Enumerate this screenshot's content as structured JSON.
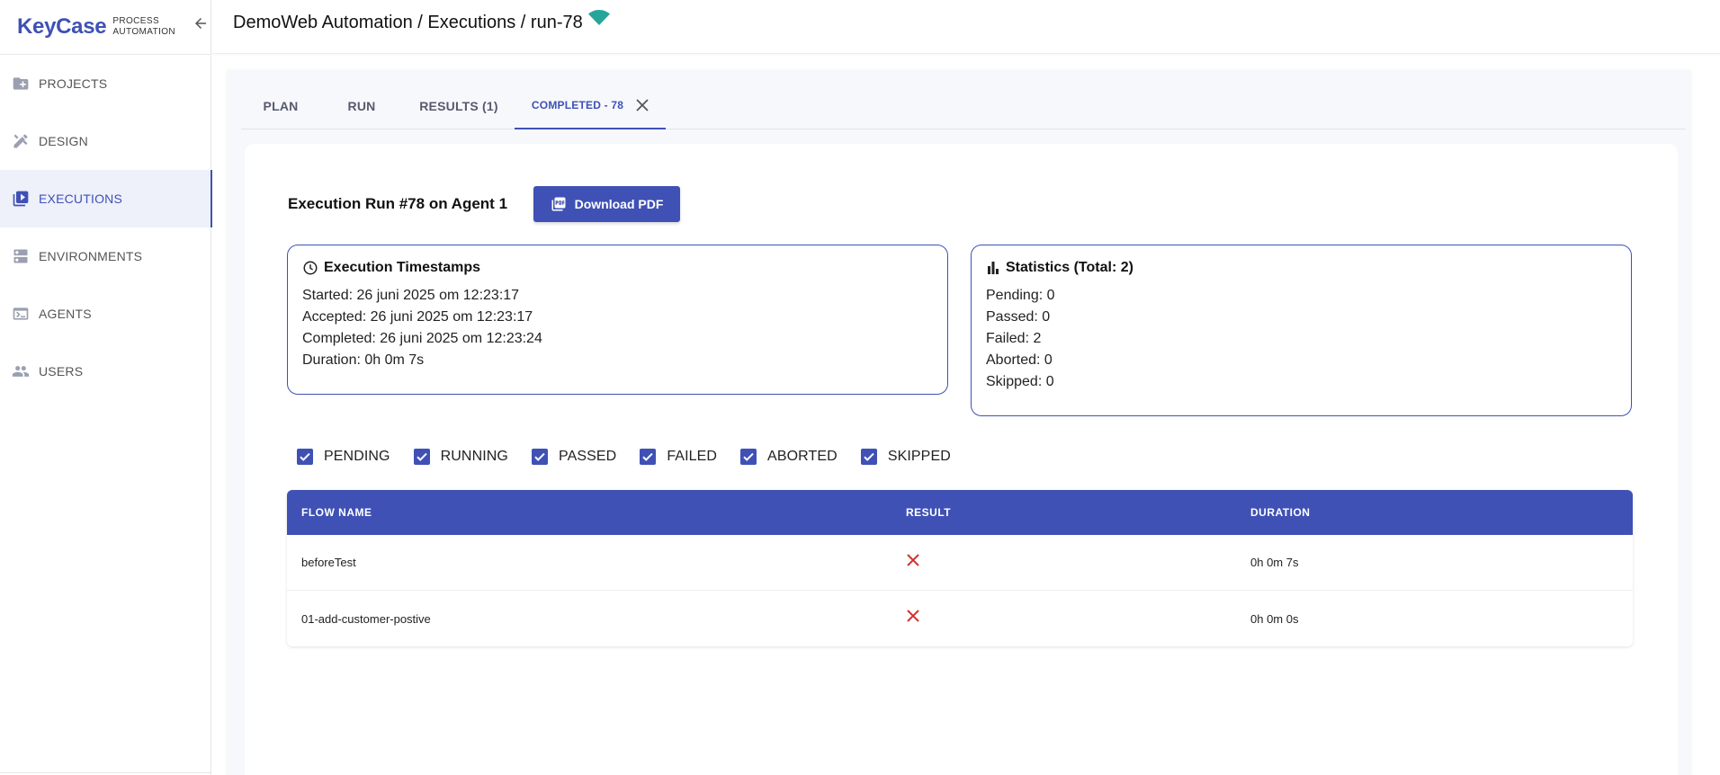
{
  "brand": {
    "name": "KeyCase",
    "sub_line1": "PROCESS",
    "sub_line2": "AUTOMATION"
  },
  "sidebar": {
    "items": [
      {
        "label": "PROJECTS",
        "icon": "folder-plus-icon"
      },
      {
        "label": "DESIGN",
        "icon": "design-tools-icon"
      },
      {
        "label": "EXECUTIONS",
        "icon": "play-library-icon",
        "active": true
      },
      {
        "label": "ENVIRONMENTS",
        "icon": "server-icon"
      },
      {
        "label": "AGENTS",
        "icon": "terminal-icon"
      },
      {
        "label": "USERS",
        "icon": "users-icon"
      }
    ]
  },
  "header": {
    "breadcrumb": "DemoWeb Automation / Executions / run-78",
    "status_icon": "wifi-icon"
  },
  "tabs": [
    {
      "label": "PLAN"
    },
    {
      "label": "RUN"
    },
    {
      "label": "RESULTS (1)"
    },
    {
      "label": "COMPLETED - 78",
      "active": true
    }
  ],
  "run": {
    "title": "Execution Run #78 on Agent 1",
    "download_label": "Download PDF"
  },
  "timestamps": {
    "title": "Execution Timestamps",
    "started": "Started: 26 juni 2025 om 12:23:17",
    "accepted": "Accepted: 26 juni 2025 om 12:23:17",
    "completed": "Completed: 26 juni 2025 om 12:23:24",
    "duration": "Duration: 0h 0m 7s"
  },
  "statistics": {
    "title": "Statistics (Total: 2)",
    "pending": "Pending: 0",
    "passed": "Passed: 0",
    "failed": "Failed: 2",
    "aborted": "Aborted: 0",
    "skipped": "Skipped: 0"
  },
  "filters": [
    {
      "label": "PENDING",
      "checked": true
    },
    {
      "label": "RUNNING",
      "checked": true
    },
    {
      "label": "PASSED",
      "checked": true
    },
    {
      "label": "FAILED",
      "checked": true
    },
    {
      "label": "ABORTED",
      "checked": true
    },
    {
      "label": "SKIPPED",
      "checked": true
    }
  ],
  "table": {
    "columns": [
      "FLOW NAME",
      "RESULT",
      "DURATION"
    ],
    "rows": [
      {
        "flow": "beforeTest",
        "result": "failed",
        "duration": "0h 0m 7s"
      },
      {
        "flow": "01-add-customer-postive",
        "result": "failed",
        "duration": "0h 0m 0s"
      }
    ]
  },
  "colors": {
    "accent": "#3f51b5",
    "fail": "#d32f2f",
    "status": "#26a69a"
  }
}
